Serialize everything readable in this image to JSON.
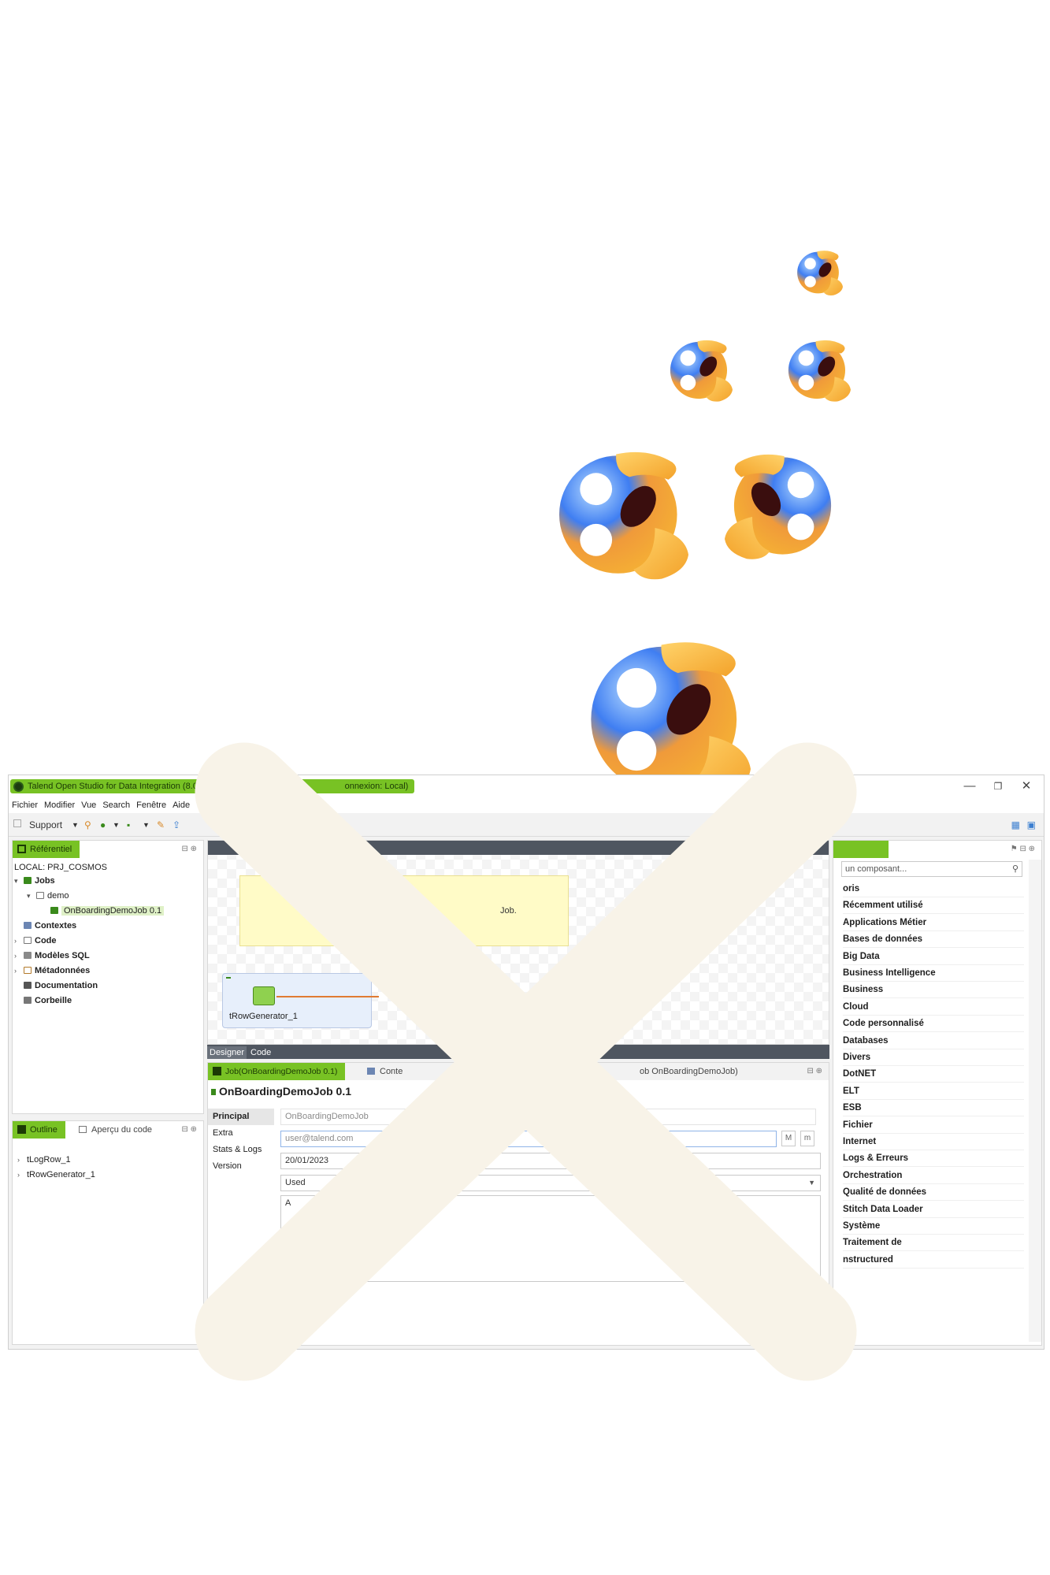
{
  "window": {
    "title": "Talend Open Studio for Data Integration (8.0.1.202",
    "title_suffix": "onnexion: Local)",
    "minimize_icon": "—",
    "restore_icon": "❐",
    "close_icon": "✕"
  },
  "menu": [
    "Fichier",
    "Modifier",
    "Vue",
    "Search",
    "Fenêtre",
    "Aide"
  ],
  "toolbar": {
    "support_label": "Support"
  },
  "repository": {
    "tab_label": "Référentiel",
    "root_label": "LOCAL: PRJ_COSMOS",
    "items": [
      {
        "label": "Jobs"
      },
      {
        "label": "demo"
      },
      {
        "label": "OnBoardingDemoJob 0.1"
      },
      {
        "label": "Contextes"
      },
      {
        "label": "Code"
      },
      {
        "label": "Modèles SQL"
      },
      {
        "label": "Métadonnées"
      },
      {
        "label": "Documentation"
      },
      {
        "label": "Corbeille"
      }
    ]
  },
  "outline": {
    "tab_label": "Outline",
    "code_tab_label": "Aperçu du code",
    "items": [
      "tLogRow_1",
      "tRowGenerator_1"
    ]
  },
  "designer": {
    "note_text": "Job.",
    "component_label": "tRowGenerator_1",
    "tabs": [
      "Designer",
      "Code"
    ]
  },
  "job_properties": {
    "tab_job": "Job(OnBoardingDemoJob 0.1)",
    "tab_context": "Conte",
    "tab_right": "ob OnBoardingDemoJob)",
    "title": "OnBoardingDemoJob 0.1",
    "vertical_tabs": [
      "Principal",
      "Extra",
      "Stats & Logs",
      "Version"
    ],
    "fields": {
      "name": "OnBoardingDemoJob",
      "author": "user@talend.com",
      "date": "20/01/2023",
      "status": "Used",
      "description": "A"
    },
    "btn_major": "M",
    "btn_minor": "m"
  },
  "palette": {
    "search_placeholder": "un composant...",
    "items": [
      "oris",
      "Récemment utilisé",
      "Applications Métier",
      "Bases de données",
      "Big Data",
      "Business Intelligence",
      "Business",
      "Cloud",
      "Code personnalisé",
      "Databases",
      "Divers",
      "DotNET",
      "ELT",
      "ESB",
      "Fichier",
      "Internet",
      "Logs & Erreurs",
      "Orchestration",
      "Qualité de données",
      "Stitch Data Loader",
      "Système",
      "Traitement de",
      "nstructured"
    ]
  },
  "colors": {
    "talend_green": "#78c224",
    "cross": "#f8f3e8",
    "emoji_yellow": "#f5a623",
    "emoji_blue": "#3b7ff0"
  },
  "icons": [
    "shocked-face-emoji",
    "cross-mark-icon"
  ]
}
